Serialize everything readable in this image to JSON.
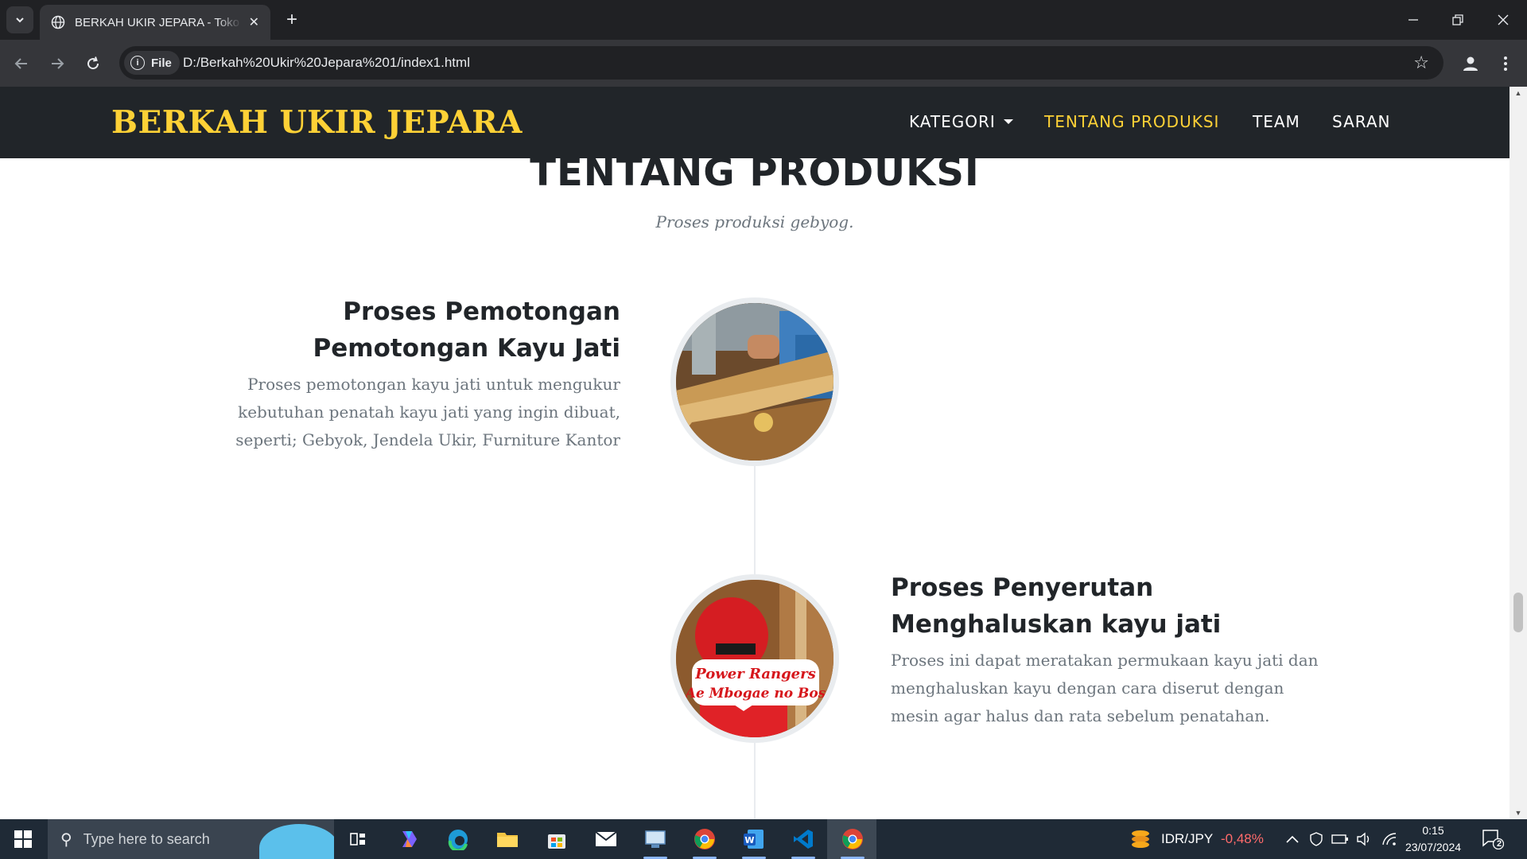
{
  "browser": {
    "tab_title": "BERKAH UKIR JEPARA - Toko Mebel Jepara",
    "tab_close": "✕",
    "new_tab": "+",
    "chip_label": "File",
    "url": "D:/Berkah%20Ukir%20Jepara%201/index1.html"
  },
  "site": {
    "brand": "BERKAH UKIR JEPARA",
    "nav": [
      {
        "label": "KATEGORI"
      },
      {
        "label": "TENTANG PRODUKSI"
      },
      {
        "label": "TEAM"
      },
      {
        "label": "SARAN"
      }
    ],
    "active_nav": "TENTANG PRODUKSI",
    "accent_color": "#fed136",
    "nav_bg": "#212529"
  },
  "section": {
    "heading": "TENTANG PRODUKSI",
    "subheading": "Proses produksi gebyog."
  },
  "timeline": [
    {
      "title_line1": "Proses Pemotongan",
      "title_line2": "Pemotongan Kayu Jati",
      "body": [
        "Proses pemotongan kayu jati untuk mengukur",
        "kebutuhan penatah kayu jati yang ingin dibuat,",
        "seperti; Gebyok, Jendela Ukir, Furniture Kantor"
      ],
      "side": "left"
    },
    {
      "title_line1": "Proses Penyerutan",
      "title_line2": "Menghaluskan kayu jati",
      "body": [
        "Proses ini dapat meratakan permukaan kayu jati dan",
        "menghaluskan kayu dengan cara diserut dengan",
        "mesin agar halus dan rata sebelum penatahan."
      ],
      "side": "right",
      "image_caption_line1": "Power Rangers",
      "image_caption_line2": "Ae Mbogae no Bos"
    }
  ],
  "taskbar": {
    "search_placeholder": "Type here to search",
    "currency_pair": "IDR/JPY",
    "currency_change": "-0,48%",
    "time": "0:15",
    "date": "23/07/2024",
    "notification_count": "2"
  }
}
